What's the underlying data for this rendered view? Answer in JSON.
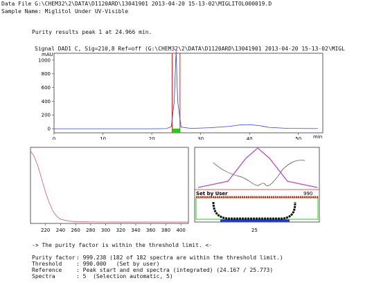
{
  "header": {
    "data_file": "Data File G:\\CHEM32\\2\\DATA\\D1120ARD\\13041901 2013-04-20 15-13-02\\MIGLITOL000019.D",
    "sample_name": "Sample Name: Miglitol Under UV-Visible"
  },
  "purity_title": "Purity results peak 1 at 24.966 min.",
  "signal_title": "Signal DAD1 C, Sig=210,8 Ref=off (G:\\CHEM32\\2\\DATA\\D1120ARD\\13041901 2013-04-20 15-13-02\\MIGL",
  "chart_data": [
    {
      "type": "line",
      "ylabel": "mAU",
      "xunit": "min",
      "xlim": [
        0,
        55
      ],
      "ylim": [
        -60,
        1100
      ],
      "x_ticks": [
        "0",
        "10",
        "20",
        "30",
        "40",
        "50"
      ],
      "y_ticks": [
        "0",
        "200",
        "400",
        "600",
        "800",
        "1000"
      ],
      "series": [
        {
          "x": [
            0,
            5,
            10,
            15,
            20,
            23,
            24,
            24.6,
            24.97,
            25.3,
            26,
            28,
            32,
            36,
            38,
            40,
            42,
            44,
            48,
            54
          ],
          "y": [
            0,
            0,
            0,
            0,
            0,
            2,
            30,
            400,
            1140,
            400,
            25,
            5,
            15,
            35,
            55,
            60,
            45,
            20,
            5,
            2
          ]
        }
      ],
      "peak_window": [
        24.167,
        25.773
      ]
    },
    {
      "type": "line",
      "x_ticks": [
        "220",
        "240",
        "260",
        "280",
        "300",
        "320",
        "340",
        "360",
        "380",
        "400"
      ],
      "xlim": [
        200,
        410
      ],
      "series": [
        {
          "x": [
            200,
            205,
            210,
            215,
            220,
            225,
            230,
            235,
            240,
            250,
            260,
            280,
            300,
            320,
            340,
            360,
            380,
            400,
            410
          ],
          "y": [
            1.0,
            0.92,
            0.78,
            0.6,
            0.42,
            0.27,
            0.15,
            0.08,
            0.04,
            0.015,
            0.005,
            0.002,
            0.001,
            0,
            0,
            0,
            0,
            0,
            0
          ]
        }
      ]
    },
    {
      "type": "line",
      "x_ticks": [
        "25"
      ],
      "xlim": [
        24.0,
        26.0
      ],
      "purity_threshold_label": "Set by User",
      "threshold_value_label": "990",
      "series": [
        {
          "name": "peak",
          "x": [
            24.0,
            24.5,
            24.8,
            25.0,
            25.2,
            25.5,
            26.0
          ],
          "y": [
            0.05,
            0.2,
            0.75,
            1.0,
            0.75,
            0.2,
            0.05
          ]
        }
      ]
    }
  ],
  "conclusion": "-> The purity factor is within the threshold limit. <-",
  "results": [
    {
      "label": "Purity factor",
      "value": ": 999.238 (182 of 182 spectra are within the threshold limit.)"
    },
    {
      "label": "Threshold",
      "value": ": 990.000   (Set by user)"
    },
    {
      "label": "Reference",
      "value": ": Peak start and end spectra (integrated) (24.167 / 25.773)"
    },
    {
      "label": "Spectra",
      "value": ": 5  (Selection automatic, 5)"
    }
  ]
}
